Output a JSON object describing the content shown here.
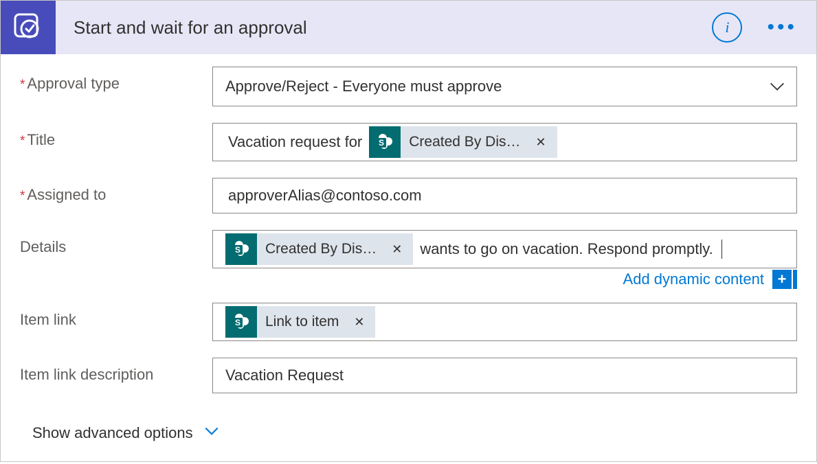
{
  "header": {
    "title": "Start and wait for an approval"
  },
  "fields": {
    "approvalType": {
      "label": "Approval type",
      "value": "Approve/Reject - Everyone must approve"
    },
    "title": {
      "label": "Title",
      "prefixText": "Vacation request for ",
      "token": "Created By Dis…"
    },
    "assignedTo": {
      "label": "Assigned to",
      "value": "approverAlias@contoso.com"
    },
    "details": {
      "label": "Details",
      "token": "Created By Dis…",
      "suffixText": " wants to go on vacation. Respond promptly."
    },
    "itemLink": {
      "label": "Item link",
      "token": "Link to item"
    },
    "itemLinkDesc": {
      "label": "Item link description",
      "value": "Vacation Request"
    }
  },
  "dynamicContent": "Add dynamic content",
  "advancedOptions": "Show advanced options",
  "icons": {
    "sharepointLetter": "S"
  }
}
